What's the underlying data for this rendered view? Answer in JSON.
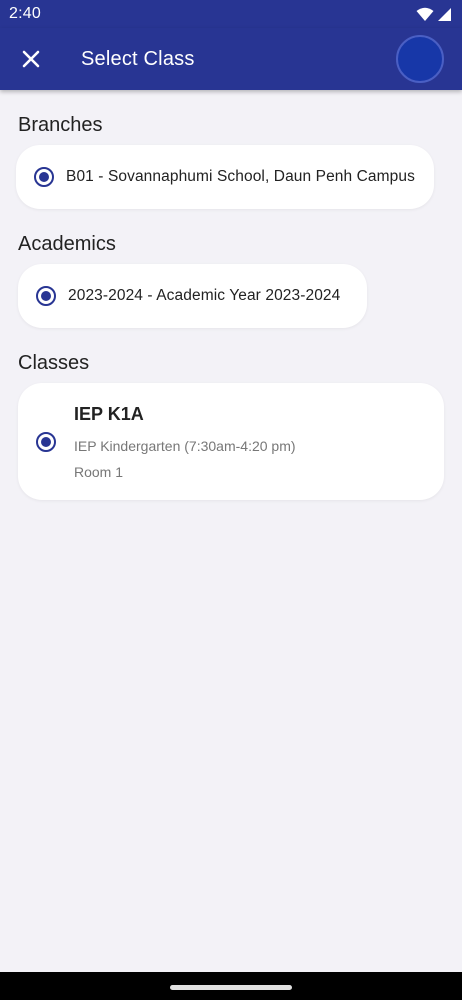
{
  "status_bar": {
    "time": "2:40"
  },
  "app_bar": {
    "title": "Select Class",
    "close_icon": "close-icon",
    "avatar_color": "#1737a8"
  },
  "branches": {
    "title": "Branches",
    "selected": "B01 - Sovannaphumi School, Daun Penh Campus"
  },
  "academics": {
    "title": "Academics",
    "selected": "2023-2024 - Academic Year 2023-2024"
  },
  "classes": {
    "title": "Classes",
    "items": [
      {
        "name": "IEP K1A",
        "program": "IEP Kindergarten (7:30am-4:20 pm)",
        "room": "Room 1",
        "selected": true
      }
    ]
  },
  "colors": {
    "primary": "#283593",
    "background": "#f3f2f7"
  }
}
